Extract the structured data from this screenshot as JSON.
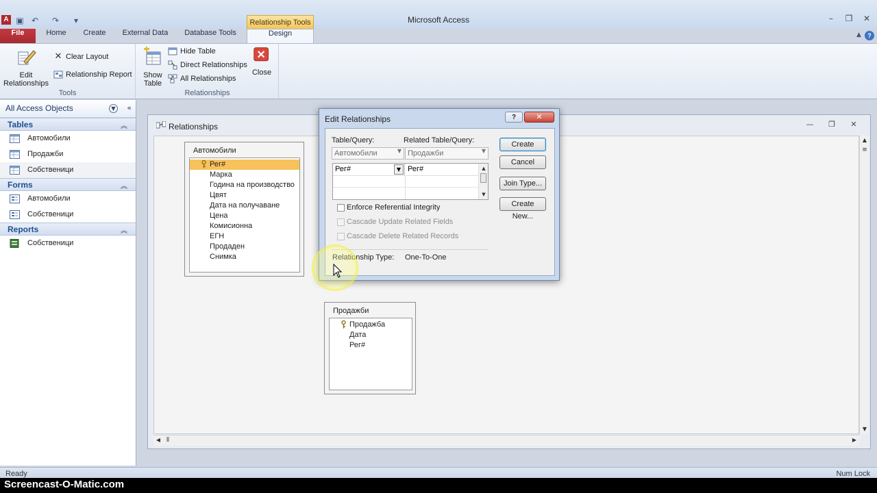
{
  "app": {
    "title": "Microsoft Access",
    "icon_letter": "A"
  },
  "quick_access": {
    "save": "save-icon",
    "undo": "undo-icon",
    "redo": "redo-icon",
    "customize": "customize-icon"
  },
  "contextual_tab_group": "Relationship Tools",
  "tabs": [
    "File",
    "Home",
    "Create",
    "External Data",
    "Database Tools",
    "Design"
  ],
  "ribbon": {
    "tools": {
      "label": "Tools",
      "edit_relationships": "Edit Relationships",
      "clear_layout": "Clear Layout",
      "relationship_report": "Relationship Report"
    },
    "relationships": {
      "label": "Relationships",
      "show_table_line1": "Show",
      "show_table_line2": "Table",
      "hide_table": "Hide Table",
      "direct_relationships": "Direct Relationships",
      "all_relationships": "All Relationships",
      "close": "Close"
    }
  },
  "nav": {
    "title": "All Access Objects",
    "sections": [
      {
        "title": "Tables",
        "items": [
          "Автомобили",
          "Продажби",
          "Собственици"
        ]
      },
      {
        "title": "Forms",
        "items": [
          "Автомобили",
          "Собственици"
        ]
      },
      {
        "title": "Reports",
        "items": [
          "Собственици"
        ]
      }
    ]
  },
  "relationships_window": {
    "title": "Relationships",
    "tables": [
      {
        "name": "Автомобили",
        "fields": [
          "Рег#",
          "Марка",
          "Година на производство",
          "Цвят",
          "Дата на получаване",
          "Цена",
          "Комисионна",
          "ЕГН",
          "Продаден",
          "Снимка"
        ],
        "key_field": "Рег#"
      },
      {
        "name": "Продажби",
        "fields": [
          "Продажба",
          "Дата",
          "Рег#"
        ],
        "key_field": "Продажба"
      }
    ]
  },
  "dialog": {
    "title": "Edit Relationships",
    "help": "?",
    "close": "✕",
    "table_query_label": "Table/Query:",
    "related_label": "Related Table/Query:",
    "table_query_value": "Автомобили",
    "related_value": "Продажби",
    "grid_left": "Рег#",
    "grid_right": "Рег#",
    "enforce_ri": "Enforce Referential Integrity",
    "cascade_update": "Cascade Update Related Fields",
    "cascade_delete": "Cascade Delete Related Records",
    "rel_type_label": "Relationship Type:",
    "rel_type_value": "One-To-One",
    "buttons": {
      "create": "Create",
      "cancel": "Cancel",
      "join_type": "Join Type...",
      "create_new": "Create New..."
    }
  },
  "status": {
    "left": "Ready",
    "right": "Num Lock"
  },
  "watermark": "Screencast-O-Matic.com",
  "colors": {
    "file_tab": "#b1272d",
    "contextual": "#f4c65a",
    "selected_field": "#f7c25b",
    "accent": "#1f4e93"
  }
}
